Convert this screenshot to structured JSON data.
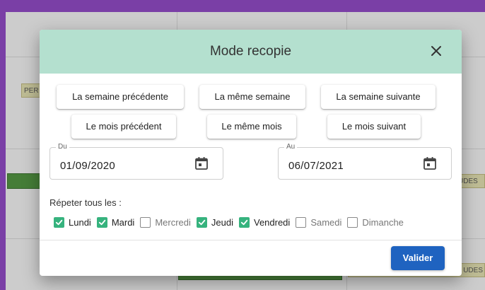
{
  "background": {
    "chips": [
      {
        "label": "PER"
      },
      {
        "label": "UDES"
      },
      {
        "label": "UDES"
      }
    ]
  },
  "dialog": {
    "title": "Mode recopie",
    "copy_buttons": [
      {
        "label": "La semaine précédente"
      },
      {
        "label": "La même semaine"
      },
      {
        "label": "La semaine suivante"
      },
      {
        "label": "Le mois précédent"
      },
      {
        "label": "Le même mois"
      },
      {
        "label": "Le mois suivant"
      }
    ],
    "from": {
      "label": "Du",
      "value": "01/09/2020"
    },
    "to": {
      "label": "Au",
      "value": "06/07/2021"
    },
    "repeat_label": "Répeter tous les :",
    "days": [
      {
        "label": "Lundi",
        "checked": true
      },
      {
        "label": "Mardi",
        "checked": true
      },
      {
        "label": "Mercredi",
        "checked": false
      },
      {
        "label": "Jeudi",
        "checked": true
      },
      {
        "label": "Vendredi",
        "checked": true
      },
      {
        "label": "Samedi",
        "checked": false
      },
      {
        "label": "Dimanche",
        "checked": false
      }
    ],
    "submit_label": "Valider"
  },
  "colors": {
    "header": "#b4e0cf",
    "accent": "#1f63c0",
    "checkbox": "#36b37e",
    "frame": "#7a3fa6"
  }
}
